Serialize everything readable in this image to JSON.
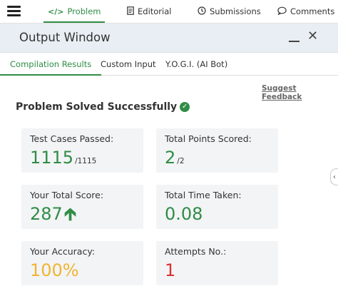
{
  "nav": {
    "tabs": [
      {
        "label": "Problem",
        "icon": "code-icon"
      },
      {
        "label": "Editorial",
        "icon": "document-icon"
      },
      {
        "label": "Submissions",
        "icon": "clock-icon"
      },
      {
        "label": "Comments",
        "icon": "speech-bubble-icon"
      }
    ],
    "active": "Problem"
  },
  "output": {
    "title": "Output Window",
    "tabs": [
      {
        "label": "Compilation Results"
      },
      {
        "label": "Custom Input"
      },
      {
        "label": "Y.O.G.I. (AI Bot)"
      }
    ],
    "active_tab": "Compilation Results",
    "suggest_feedback": "Suggest Feedback",
    "status": "Problem Solved Successfully"
  },
  "stats": {
    "test_cases": {
      "label": "Test Cases Passed:",
      "value": "1115",
      "suffix": "/1115"
    },
    "points": {
      "label": "Total Points Scored:",
      "value": "2",
      "suffix": "/2"
    },
    "score": {
      "label": "Your Total Score:",
      "value": "287"
    },
    "time": {
      "label": "Total Time Taken:",
      "value": "0.08"
    },
    "accuracy": {
      "label": "Your Accuracy:",
      "value": "100%"
    },
    "attempts": {
      "label": "Attempts No.:",
      "value": "1"
    }
  },
  "colors": {
    "accent_green": "#2f8d46",
    "accuracy_orange": "#f0b431",
    "attempts_red": "#d9302f",
    "header_bg": "#e8eef3",
    "card_bg": "#f3f4f6"
  }
}
